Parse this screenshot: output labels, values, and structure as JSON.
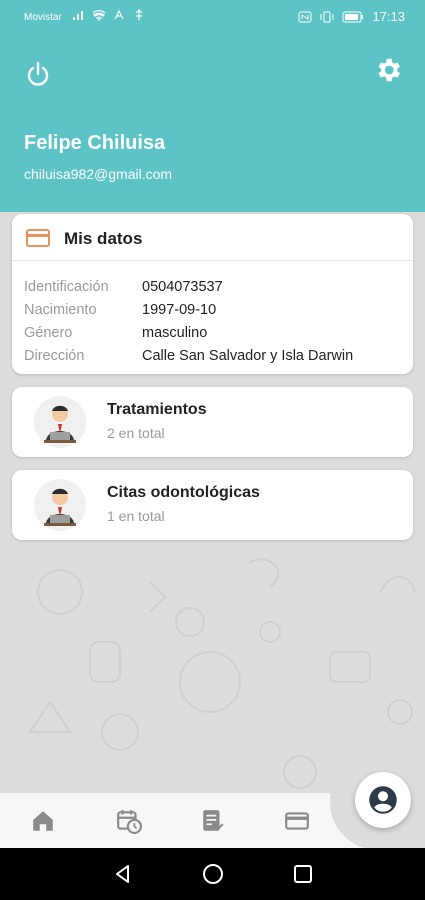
{
  "status_bar": {
    "carrier": "Movistar",
    "time": "17:13"
  },
  "header": {
    "user_name": "Felipe Chiluisa",
    "user_email": "chiluisa982@gmail.com",
    "power_icon": "power-icon",
    "settings_icon": "gear-icon",
    "background_color": "#5cc3c6"
  },
  "mis_datos": {
    "title": "Mis datos",
    "icon": "card-icon",
    "icon_color": "#e8935a",
    "rows": [
      {
        "label": "Identificación",
        "value": "0504073537"
      },
      {
        "label": "Nacimiento",
        "value": "1997-09-10"
      },
      {
        "label": "Género",
        "value": "masculino"
      },
      {
        "label": "Dirección",
        "value": "Calle San Salvador y Isla Darwin"
      }
    ]
  },
  "items": [
    {
      "title": "Tratamientos",
      "subtitle": "2 en total",
      "icon": "doctor-avatar-icon"
    },
    {
      "title": "Citas odontológicas",
      "subtitle": "1 en total",
      "icon": "doctor-avatar-icon"
    }
  ],
  "bottom_nav": {
    "items": [
      "home-icon",
      "calendar-clock-icon",
      "checklist-icon",
      "credit-card-icon"
    ],
    "fab_icon": "account-circle-icon"
  },
  "android_nav": [
    "back-icon",
    "home-circle-icon",
    "recent-apps-icon"
  ]
}
